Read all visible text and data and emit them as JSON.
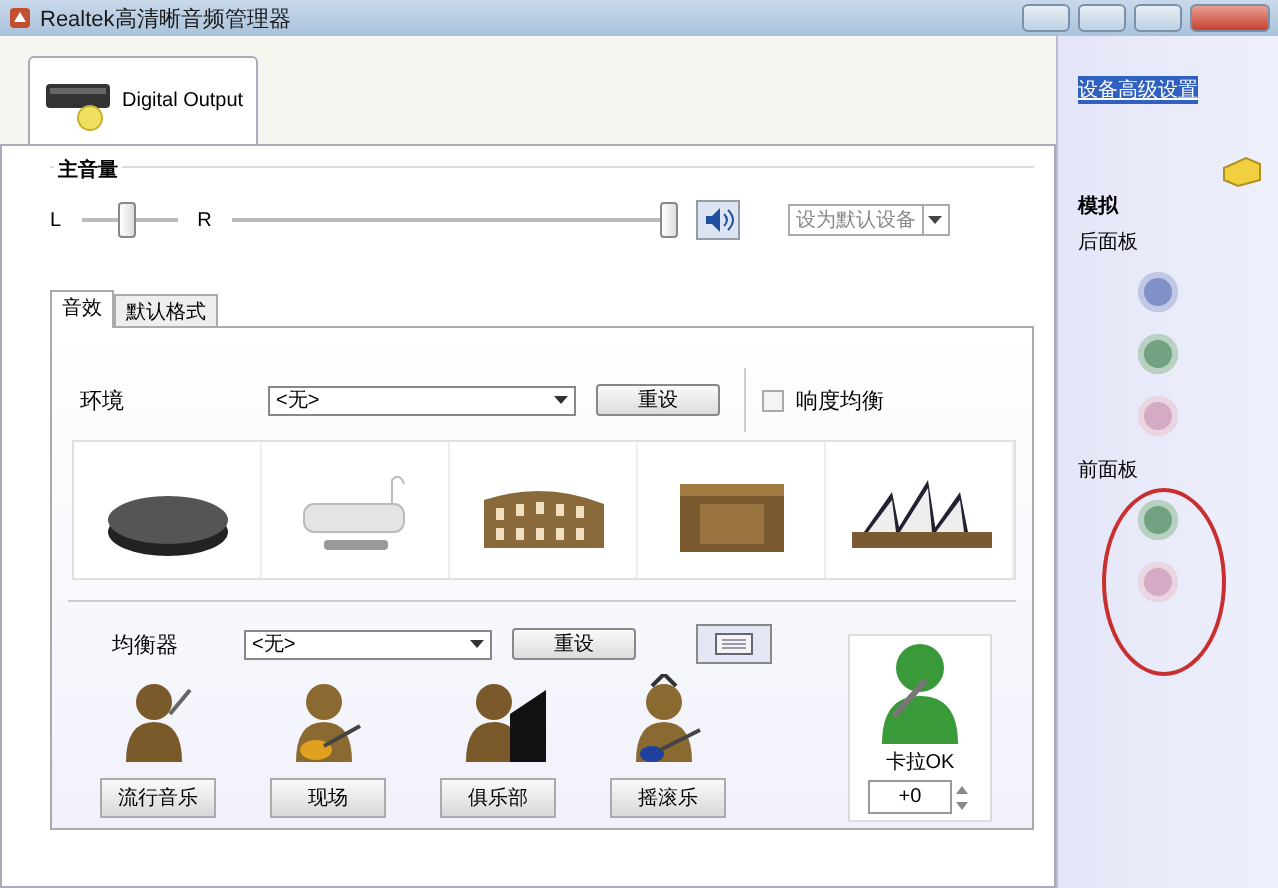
{
  "window": {
    "title": "Realtek高清晰音频管理器"
  },
  "device_tabs": [
    {
      "label": "Digital Output",
      "selected": true
    }
  ],
  "master_volume": {
    "label": "主音量",
    "left_label": "L",
    "right_label": "R",
    "balance": {
      "level": 0.45
    },
    "volume": {
      "level": 1.0
    },
    "muted": false
  },
  "default_device": {
    "label": "设为默认设备",
    "disabled": true
  },
  "tabs": [
    {
      "label": "音效",
      "selected": true
    },
    {
      "label": "默认格式",
      "selected": false
    }
  ],
  "environment": {
    "label": "环境",
    "value": "<无>",
    "reset": "重设"
  },
  "loudness": {
    "label": "响度均衡",
    "checked": false
  },
  "environments": [
    {
      "kind": "stone"
    },
    {
      "kind": "bathtub"
    },
    {
      "kind": "colosseum"
    },
    {
      "kind": "box"
    },
    {
      "kind": "opera"
    }
  ],
  "equalizer": {
    "label": "均衡器",
    "value": "<无>",
    "reset": "重设"
  },
  "presets": [
    {
      "label": "流行音乐",
      "kind": "singer"
    },
    {
      "label": "现场",
      "kind": "guitar"
    },
    {
      "label": "俱乐部",
      "kind": "piano"
    },
    {
      "label": "摇滚乐",
      "kind": "rock"
    }
  ],
  "karaoke": {
    "label": "卡拉OK",
    "value": "+0"
  },
  "side_panel": {
    "link": "设备高级设置",
    "section": "模拟",
    "groups": [
      {
        "label": "后面板",
        "highlighted": false,
        "jacks": [
          {
            "color": "#8290c8"
          },
          {
            "color": "#72a282"
          },
          {
            "color": "#d4aac4"
          }
        ]
      },
      {
        "label": "前面板",
        "highlighted": true,
        "jacks": [
          {
            "color": "#72a282"
          },
          {
            "color": "#d4aac4"
          }
        ]
      }
    ]
  }
}
